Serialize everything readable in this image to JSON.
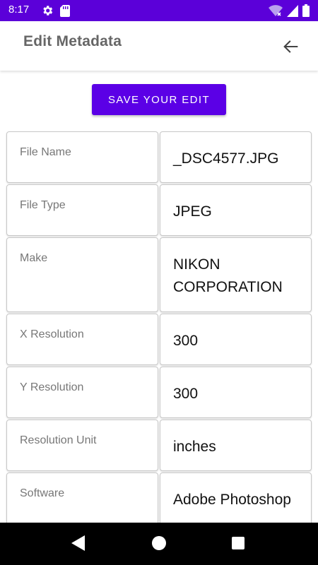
{
  "status_bar": {
    "time": "8:17",
    "background": "#5b00d9",
    "left_icons": [
      "gear-icon",
      "sd-card-icon"
    ],
    "right_icons": [
      "wifi-icon",
      "signal-icon",
      "battery-icon"
    ]
  },
  "app_bar": {
    "title": "Edit Metadata",
    "back_icon": "arrow-left-icon"
  },
  "save_button": {
    "label": "SAVE YOUR EDIT",
    "color": "#5b00e6"
  },
  "metadata": [
    {
      "key": "File Name",
      "value": "_DSC4577.JPG"
    },
    {
      "key": "File Type",
      "value": "JPEG"
    },
    {
      "key": "Make",
      "value": "NIKON CORPORATION"
    },
    {
      "key": "X Resolution",
      "value": "300"
    },
    {
      "key": "Y Resolution",
      "value": "300"
    },
    {
      "key": "Resolution Unit",
      "value": "inches"
    },
    {
      "key": "Software",
      "value": "Adobe Photoshop"
    }
  ],
  "nav_bar": {
    "icons": [
      "nav-back-icon",
      "nav-home-icon",
      "nav-recents-icon"
    ]
  }
}
